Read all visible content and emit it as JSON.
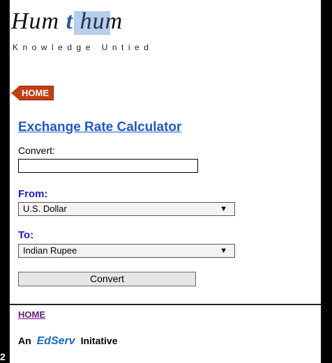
{
  "logo": {
    "text_a": "Hum",
    "text_t": "t",
    "text_b": "hum",
    "tagline": "Knowledge Untied"
  },
  "nav": {
    "home_badge": "HOME"
  },
  "calculator": {
    "title": "Exchange Rate Calculator",
    "convert_label": "Convert:",
    "convert_value": "",
    "from_label": "From:",
    "from_selected": "U.S. Dollar",
    "to_label": "To:",
    "to_selected": "Indian Rupee",
    "convert_button": "Convert"
  },
  "footer": {
    "home_link": "HOME",
    "prefix": "An",
    "brand": "EdServ",
    "suffix": "Initative"
  },
  "page_number": "2",
  "colors": {
    "title_blue": "#1e59c8",
    "label_blue": "#1a1ad9",
    "home_badge": "#c43e12",
    "link_purple": "#6a1b7e"
  }
}
